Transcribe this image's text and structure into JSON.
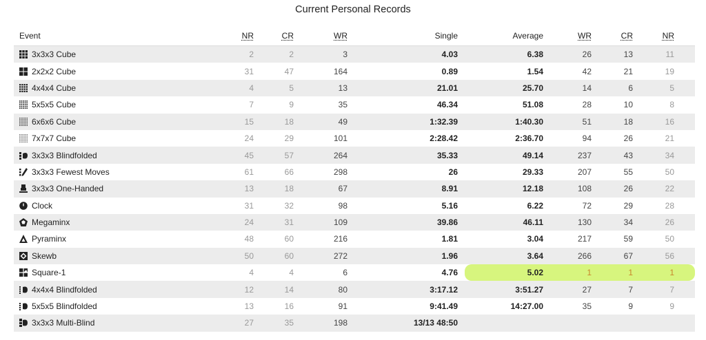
{
  "title": "Current Personal Records",
  "headers": {
    "event": "Event",
    "nr": "NR",
    "cr": "CR",
    "wr": "WR",
    "single": "Single",
    "average": "Average",
    "wr2": "WR",
    "cr2": "CR",
    "nr2": "NR"
  },
  "rows": [
    {
      "icon": "3x3-cube-icon",
      "event": "3x3x3 Cube",
      "nr": "2",
      "cr": "2",
      "wr": "3",
      "single": "4.03",
      "average": "6.38",
      "awr": "26",
      "acr": "13",
      "anr": "11"
    },
    {
      "icon": "2x2-cube-icon",
      "event": "2x2x2 Cube",
      "nr": "31",
      "cr": "47",
      "wr": "164",
      "single": "0.89",
      "average": "1.54",
      "awr": "42",
      "acr": "21",
      "anr": "19"
    },
    {
      "icon": "4x4-cube-icon",
      "event": "4x4x4 Cube",
      "nr": "4",
      "cr": "5",
      "wr": "13",
      "single": "21.01",
      "average": "25.70",
      "awr": "14",
      "acr": "6",
      "anr": "5"
    },
    {
      "icon": "5x5-cube-icon",
      "event": "5x5x5 Cube",
      "nr": "7",
      "cr": "9",
      "wr": "35",
      "single": "46.34",
      "average": "51.08",
      "awr": "28",
      "acr": "10",
      "anr": "8"
    },
    {
      "icon": "6x6-cube-icon",
      "event": "6x6x6 Cube",
      "nr": "15",
      "cr": "18",
      "wr": "49",
      "single": "1:32.39",
      "average": "1:40.30",
      "awr": "51",
      "acr": "18",
      "anr": "16"
    },
    {
      "icon": "7x7-cube-icon",
      "event": "7x7x7 Cube",
      "nr": "24",
      "cr": "29",
      "wr": "101",
      "single": "2:28.42",
      "average": "2:36.70",
      "awr": "94",
      "acr": "26",
      "anr": "21"
    },
    {
      "icon": "blindfolded-icon",
      "event": "3x3x3 Blindfolded",
      "nr": "45",
      "cr": "57",
      "wr": "264",
      "single": "35.33",
      "average": "49.14",
      "awr": "237",
      "acr": "43",
      "anr": "34"
    },
    {
      "icon": "fewest-moves-icon",
      "event": "3x3x3 Fewest Moves",
      "nr": "61",
      "cr": "66",
      "wr": "298",
      "single": "26",
      "average": "29.33",
      "awr": "207",
      "acr": "55",
      "anr": "50"
    },
    {
      "icon": "one-handed-icon",
      "event": "3x3x3 One-Handed",
      "nr": "13",
      "cr": "18",
      "wr": "67",
      "single": "8.91",
      "average": "12.18",
      "awr": "108",
      "acr": "26",
      "anr": "22"
    },
    {
      "icon": "clock-icon",
      "event": "Clock",
      "nr": "31",
      "cr": "32",
      "wr": "98",
      "single": "5.16",
      "average": "6.22",
      "awr": "72",
      "acr": "29",
      "anr": "28"
    },
    {
      "icon": "megaminx-icon",
      "event": "Megaminx",
      "nr": "24",
      "cr": "31",
      "wr": "109",
      "single": "39.86",
      "average": "46.11",
      "awr": "130",
      "acr": "34",
      "anr": "26"
    },
    {
      "icon": "pyraminx-icon",
      "event": "Pyraminx",
      "nr": "48",
      "cr": "60",
      "wr": "216",
      "single": "1.81",
      "average": "3.04",
      "awr": "217",
      "acr": "59",
      "anr": "50"
    },
    {
      "icon": "skewb-icon",
      "event": "Skewb",
      "nr": "50",
      "cr": "60",
      "wr": "272",
      "single": "1.96",
      "average": "3.64",
      "awr": "266",
      "acr": "67",
      "anr": "56"
    },
    {
      "icon": "square-1-icon",
      "event": "Square-1",
      "nr": "4",
      "cr": "4",
      "wr": "6",
      "single": "4.76",
      "average": "5.02",
      "awr": "1",
      "acr": "1",
      "anr": "1",
      "highlight": true
    },
    {
      "icon": "4x4-blindfolded-icon",
      "event": "4x4x4 Blindfolded",
      "nr": "12",
      "cr": "14",
      "wr": "80",
      "single": "3:17.12",
      "average": "3:51.27",
      "awr": "27",
      "acr": "7",
      "anr": "7"
    },
    {
      "icon": "5x5-blindfolded-icon",
      "event": "5x5x5 Blindfolded",
      "nr": "13",
      "cr": "16",
      "wr": "91",
      "single": "9:41.49",
      "average": "14:27.00",
      "awr": "35",
      "acr": "9",
      "anr": "9"
    },
    {
      "icon": "multi-blind-icon",
      "event": "3x3x3 Multi-Blind",
      "nr": "27",
      "cr": "35",
      "wr": "198",
      "single": "13/13 48:50",
      "average": "",
      "awr": "",
      "acr": "",
      "anr": ""
    }
  ],
  "colors": {
    "stripe": "#ececec",
    "highlight": "#d7f57e",
    "highlight_rank": "#c9862a"
  }
}
